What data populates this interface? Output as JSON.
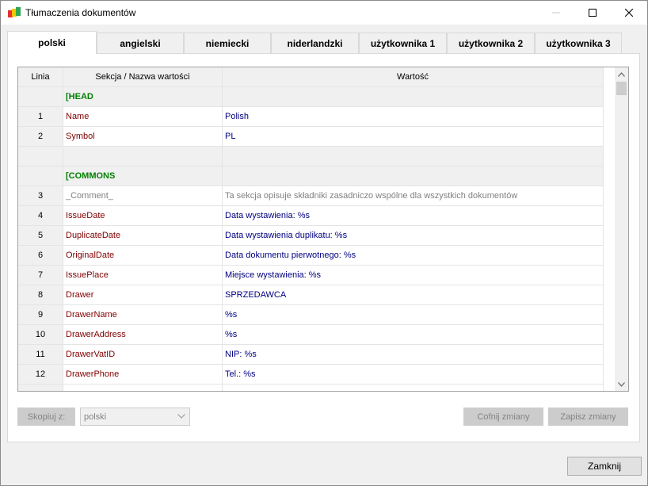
{
  "window": {
    "title": "Tłumaczenia dokumentów"
  },
  "tabs": [
    {
      "label": "polski",
      "active": true
    },
    {
      "label": "angielski"
    },
    {
      "label": "niemiecki"
    },
    {
      "label": "niderlandzki"
    },
    {
      "label": "użytkownika 1"
    },
    {
      "label": "użytkownika 2"
    },
    {
      "label": "użytkownika 3"
    }
  ],
  "grid": {
    "columns": [
      "Linia",
      "Sekcja / Nazwa wartości",
      "Wartość"
    ],
    "rows": [
      {
        "type": "section",
        "line": "",
        "name": "[HEAD",
        "value": ""
      },
      {
        "type": "entry",
        "line": "1",
        "name": "Name",
        "value": "Polish"
      },
      {
        "type": "entry",
        "line": "2",
        "name": "Symbol",
        "value": "PL"
      },
      {
        "type": "blank",
        "line": "",
        "name": "",
        "value": ""
      },
      {
        "type": "section",
        "line": "",
        "name": "[COMMONS",
        "value": ""
      },
      {
        "type": "comment",
        "line": "3",
        "name": "_Comment_",
        "value": "Ta sekcja opisuje składniki zasadniczo wspólne dla wszystkich dokumentów"
      },
      {
        "type": "entry",
        "line": "4",
        "name": "IssueDate",
        "value": "Data wystawienia: %s"
      },
      {
        "type": "entry",
        "line": "5",
        "name": "DuplicateDate",
        "value": "Data wystawienia duplikatu: %s"
      },
      {
        "type": "entry",
        "line": "6",
        "name": "OriginalDate",
        "value": "Data dokumentu pierwotnego: %s"
      },
      {
        "type": "entry",
        "line": "7",
        "name": "IssuePlace",
        "value": "Miejsce wystawienia: %s"
      },
      {
        "type": "entry",
        "line": "8",
        "name": "Drawer",
        "value": "SPRZEDAWCA"
      },
      {
        "type": "entry",
        "line": "9",
        "name": "DrawerName",
        "value": "%s"
      },
      {
        "type": "entry",
        "line": "10",
        "name": "DrawerAddress",
        "value": "%s"
      },
      {
        "type": "entry",
        "line": "11",
        "name": "DrawerVatID",
        "value": "NIP: %s"
      },
      {
        "type": "entry",
        "line": "12",
        "name": "DrawerPhone",
        "value": "Tel.: %s"
      },
      {
        "type": "entry",
        "line": "",
        "name": "",
        "value": ""
      }
    ]
  },
  "bottom": {
    "copy_label": "Skopiuj z:",
    "copy_source": "polski",
    "undo_label": "Cofnij zmiany",
    "save_label": "Zapisz zmiany"
  },
  "close_label": "Zamknij",
  "colors": {
    "section": "#008000",
    "key": "#800000",
    "value": "#000080",
    "comment": "#808080"
  }
}
